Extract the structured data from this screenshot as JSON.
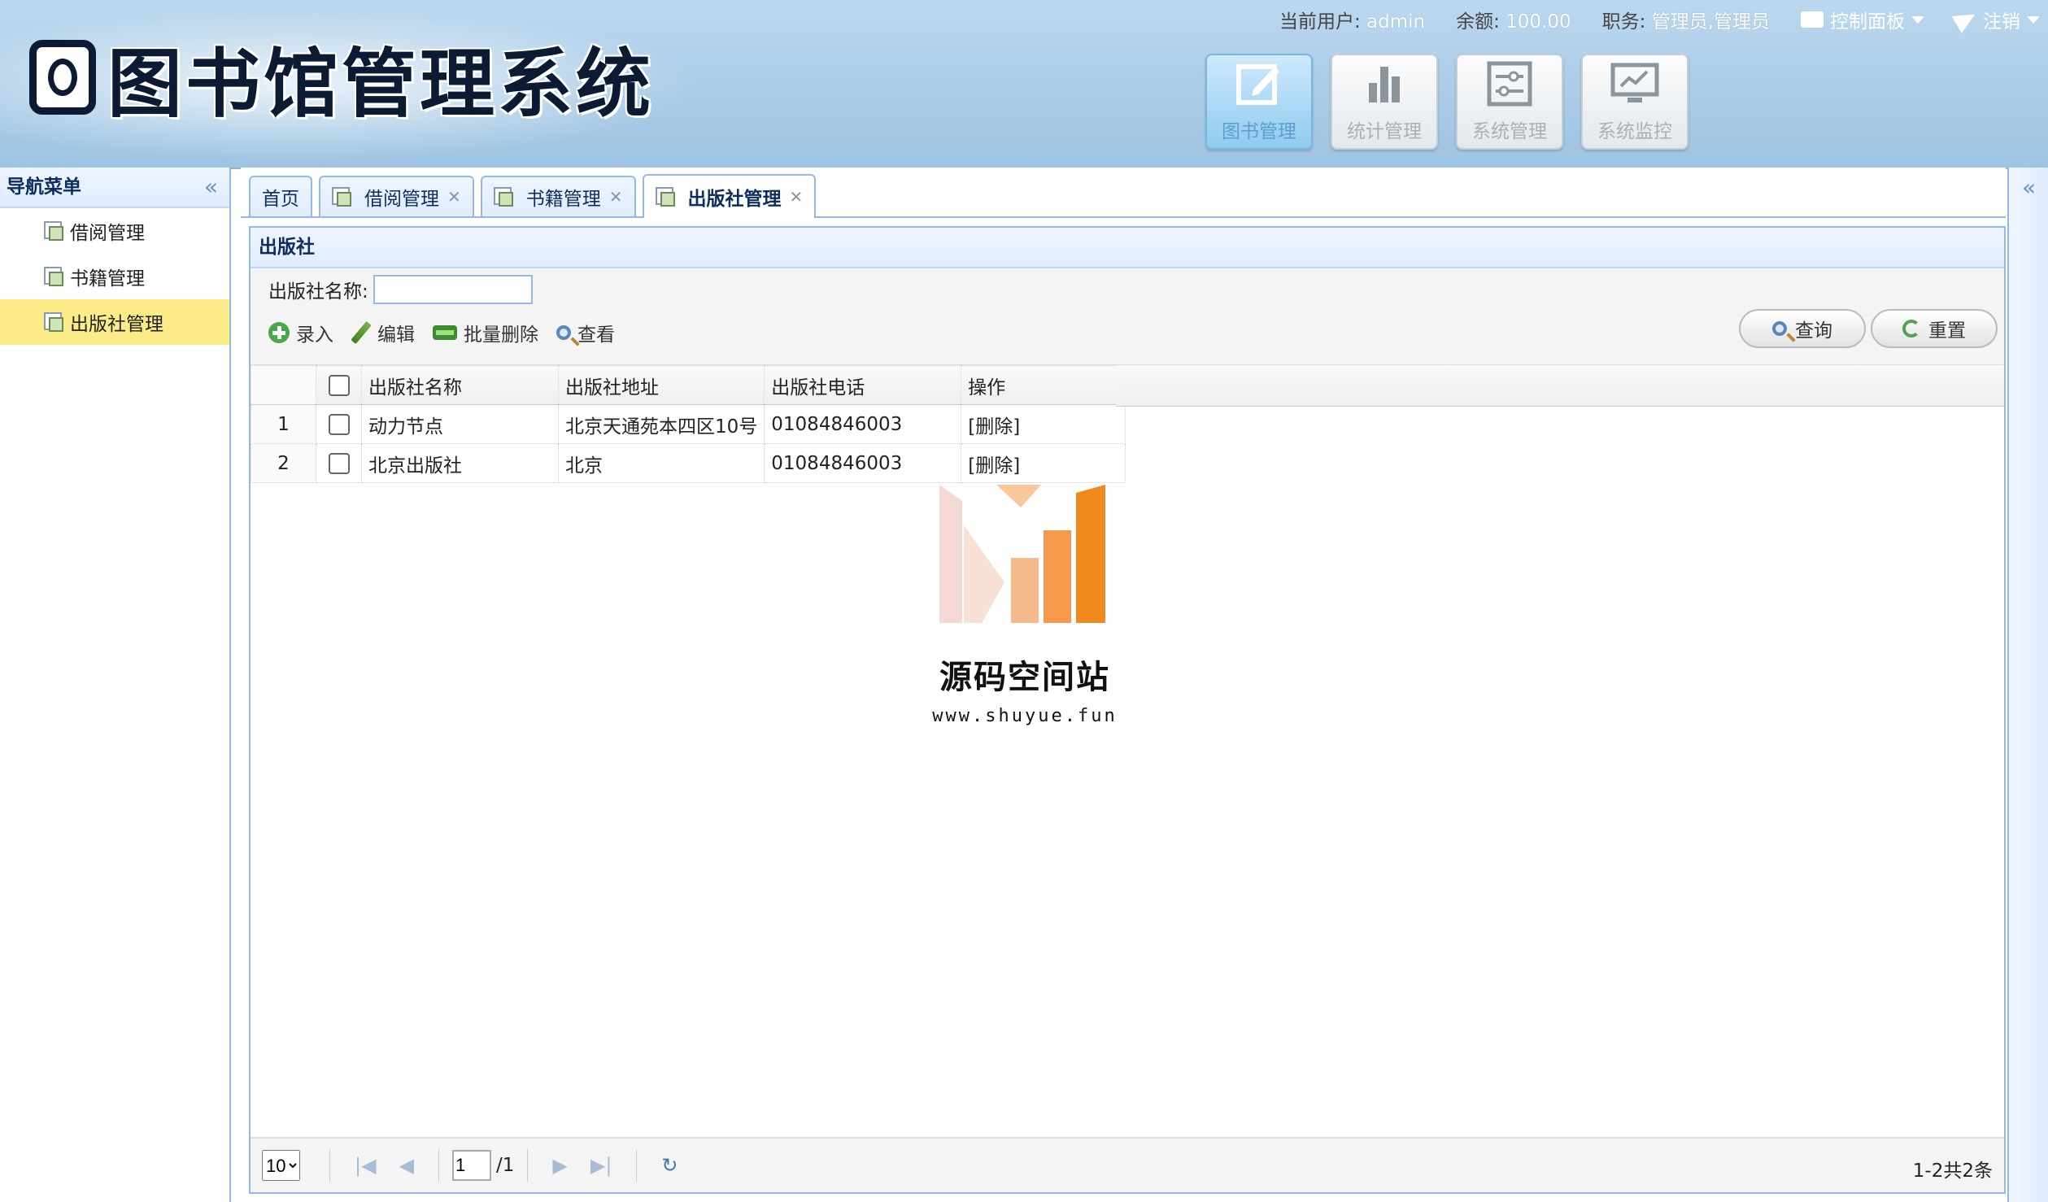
{
  "header": {
    "logo_text": "图书馆管理系统",
    "current_user_label": "当前用户:",
    "current_user": "admin",
    "balance_label": "余额:",
    "balance": "100.00",
    "role_label": "职务:",
    "role": "管理员,管理员",
    "control_panel": "控制面板",
    "logout": "注销",
    "modules": [
      "图书管理",
      "统计管理",
      "系统管理",
      "系统监控"
    ]
  },
  "nav": {
    "title": "导航菜单",
    "items": [
      "借阅管理",
      "书籍管理",
      "出版社管理"
    ],
    "selected_index": 2
  },
  "tabs": [
    {
      "label": "首页",
      "closable": false
    },
    {
      "label": "借阅管理",
      "closable": true
    },
    {
      "label": "书籍管理",
      "closable": true
    },
    {
      "label": "出版社管理",
      "closable": true,
      "active": true
    }
  ],
  "panel": {
    "title": "出版社",
    "search_label": "出版社名称:",
    "search_value": "",
    "actions": [
      "录入",
      "编辑",
      "批量删除",
      "查看"
    ],
    "query_button": "查询",
    "reset_button": "重置"
  },
  "table": {
    "columns": [
      "出版社名称",
      "出版社地址",
      "出版社电话",
      "操作"
    ],
    "rows": [
      {
        "num": "1",
        "name": "动力节点",
        "address": "北京天通苑本四区10号",
        "phone": "01084846003",
        "op": "[删除]"
      },
      {
        "num": "2",
        "name": "北京出版社",
        "address": "北京",
        "phone": "01084846003",
        "op": "[删除]"
      }
    ]
  },
  "watermark": {
    "title": "源码空间站",
    "url": "www.shuyue.fun"
  },
  "pager": {
    "page_size": "10",
    "page": "1",
    "total_pages": "/1",
    "info": "1-2共2条"
  },
  "colors": {
    "header_bg": "#a9cbe6",
    "selected_nav": "#fbec88",
    "border_blue": "#95b8e7"
  }
}
